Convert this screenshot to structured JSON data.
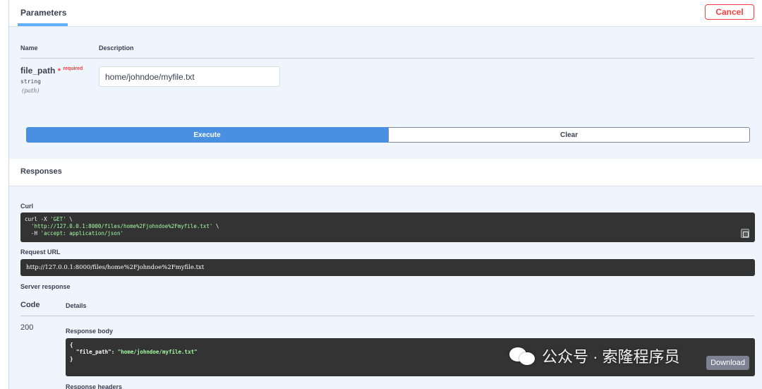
{
  "parameters": {
    "title": "Parameters",
    "cancel_label": "Cancel",
    "columns": {
      "name": "Name",
      "description": "Description"
    },
    "param": {
      "name": "file_path",
      "required_star": "*",
      "required_label": "required",
      "type": "string",
      "location": "(path)",
      "value": "home/johndoe/myfile.txt"
    },
    "execute_label": "Execute",
    "clear_label": "Clear"
  },
  "responses": {
    "title": "Responses",
    "curl_label": "Curl",
    "curl": {
      "line1_cmd": "curl -X ",
      "line1_method": "'GET'",
      "line1_end": " \\",
      "line2_url": "'http://127.0.0.1:8000/files/home%2Fjohndoe%2Fmyfile.txt'",
      "line2_end": " \\",
      "line3_flag": "  -H ",
      "line3_header": "'accept: application/json'"
    },
    "request_url_label": "Request URL",
    "request_url": "http://127.0.0.1:8000/files/home%2Fjohndoe%2Fmyfile.txt",
    "server_response_label": "Server response",
    "code_header": "Code",
    "details_header": "Details",
    "code_value": "200",
    "response_body_label": "Response body",
    "body": {
      "open": "{",
      "key": "\"file_path\"",
      "colon": ": ",
      "value": "\"home/johndoe/myfile.txt\"",
      "close": "}"
    },
    "download_label": "Download",
    "response_headers_label": "Response headers"
  },
  "watermark": {
    "text": "公众号 · 索隆程序员"
  }
}
